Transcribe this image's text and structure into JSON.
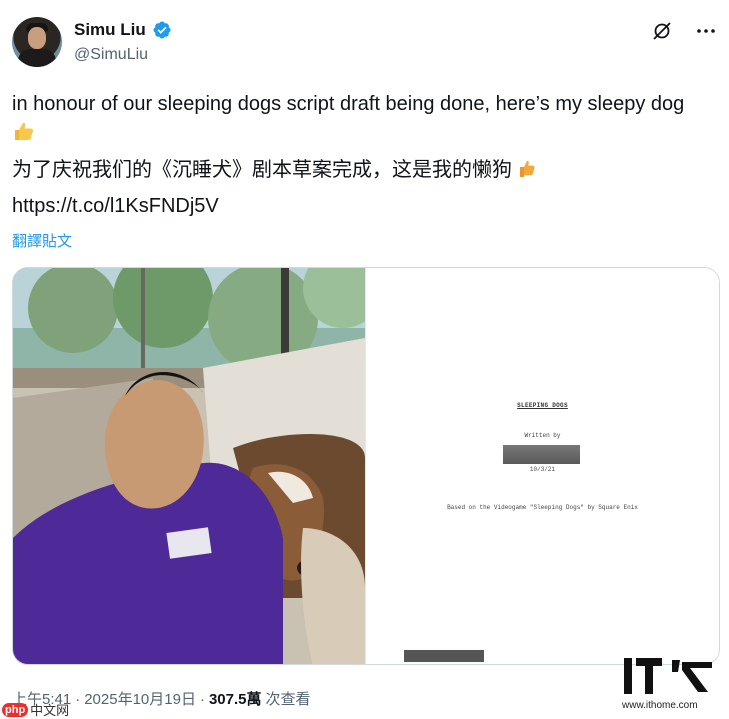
{
  "author": {
    "display_name": "Simu Liu",
    "handle": "@SimuLiu",
    "verified": true,
    "verified_color": "#1d9bf0"
  },
  "actions": {
    "grok_icon": "grok-icon",
    "more_icon": "more-icon"
  },
  "tweet": {
    "text_en": "in honour of our sleeping dogs script draft being done, here’s my sleepy dog",
    "text_zh": "为了庆祝我们的《沉睡犬》剧本草案完成，这是我的懒狗",
    "link": "https://t.co/l1KsFNDj5V",
    "translate_label": "翻譯貼文"
  },
  "media": {
    "script_page": {
      "title": "SLEEPING DOGS",
      "written_by": "Written by",
      "date": "10/3/21",
      "based_on": "Based on the Videogame \"Sleeping Dogs\" by Square Enix"
    }
  },
  "meta": {
    "time": "上午5:41",
    "sep1": "·",
    "date": "2025年10月19日",
    "sep2": "·",
    "views": "307.5萬",
    "views_label": "次查看"
  },
  "watermarks": {
    "php_badge": "php",
    "php_text": "中文网",
    "ithome_url": "www.ithome.com"
  },
  "colors": {
    "accent": "#1d9bf0",
    "text": "#0f1419",
    "secondary": "#536471",
    "border": "#cfd9de"
  }
}
